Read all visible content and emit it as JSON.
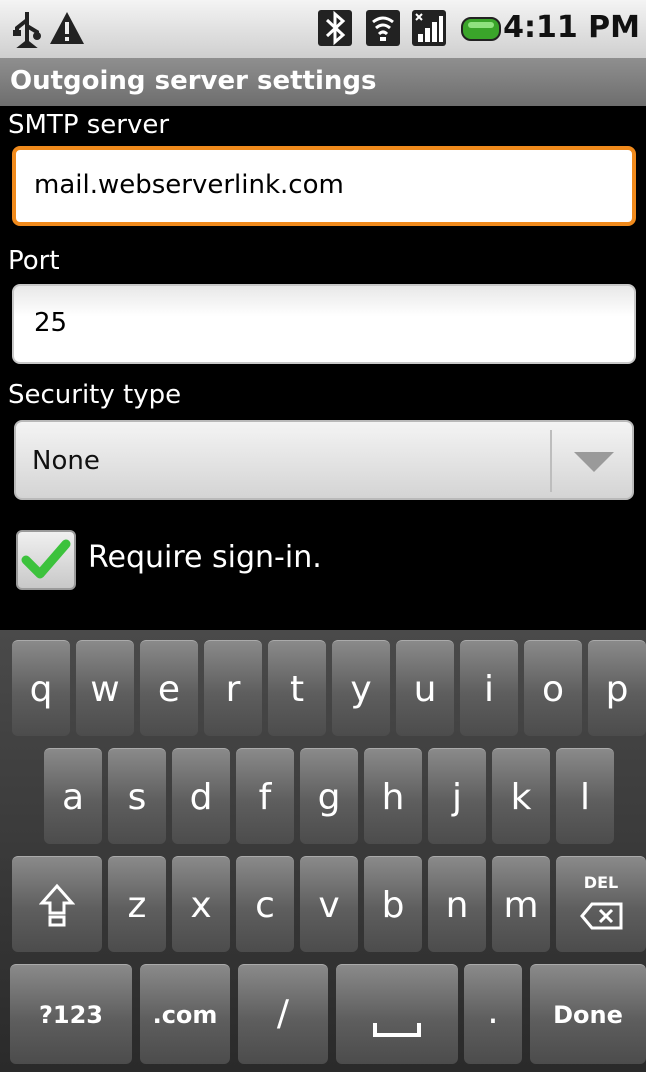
{
  "status_bar": {
    "time": "4:11 PM",
    "icons": [
      "usb-icon",
      "warning-icon",
      "bluetooth-icon",
      "wifi-icon",
      "signal-icon",
      "battery-icon"
    ]
  },
  "title": "Outgoing server settings",
  "form": {
    "smtp_label": "SMTP server",
    "smtp_value": "mail.webserverlink.com",
    "port_label": "Port",
    "port_value": "25",
    "security_label": "Security type",
    "security_value": "None",
    "require_signin_label": "Require sign-in.",
    "require_signin_checked": true
  },
  "keyboard": {
    "row1": [
      "q",
      "w",
      "e",
      "r",
      "t",
      "y",
      "u",
      "i",
      "o",
      "p"
    ],
    "row2": [
      "a",
      "s",
      "d",
      "f",
      "g",
      "h",
      "j",
      "k",
      "l"
    ],
    "row3": [
      "z",
      "x",
      "c",
      "v",
      "b",
      "n",
      "m"
    ],
    "del_label": "DEL",
    "num_label": "?123",
    "com_label": ".com",
    "slash_label": "/",
    "dot_label": ".",
    "done_label": "Done"
  },
  "colors": {
    "focus": "#f08a1c",
    "check": "#3cc23c"
  }
}
